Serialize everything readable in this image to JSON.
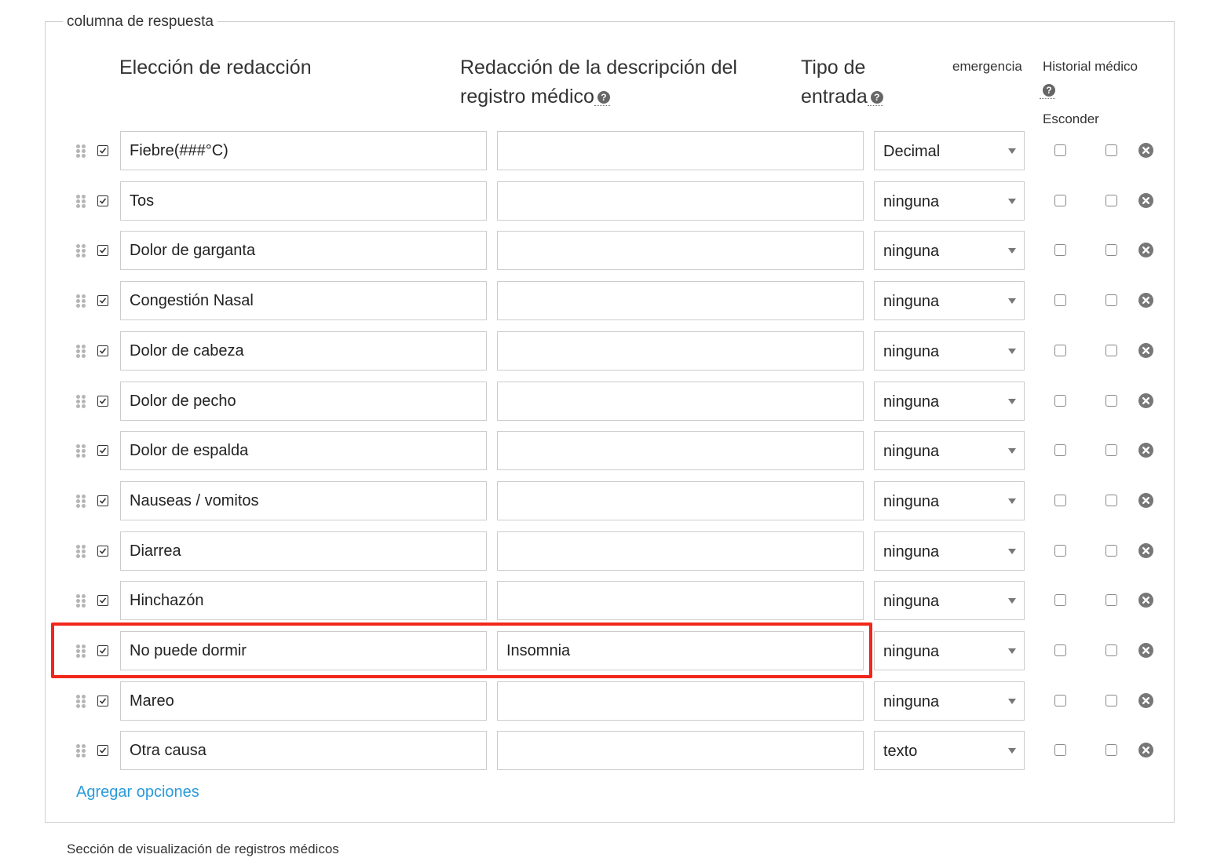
{
  "fieldset": {
    "legend": "columna de respuesta",
    "headers": {
      "choice": "Elección de redacción",
      "description": "Redacción de la descripción del registro médico",
      "input_type": "Tipo de entrada",
      "emergency": "emergencia",
      "medical_history": "Historial médico",
      "hide": "Esconder"
    },
    "rows": [
      {
        "choice": "Fiebre(###°C)",
        "description": "",
        "input_type": "Decimal"
      },
      {
        "choice": "Tos",
        "description": "",
        "input_type": "ninguna"
      },
      {
        "choice": "Dolor de garganta",
        "description": "",
        "input_type": "ninguna"
      },
      {
        "choice": "Congestión Nasal",
        "description": "",
        "input_type": "ninguna"
      },
      {
        "choice": "Dolor de cabeza",
        "description": "",
        "input_type": "ninguna"
      },
      {
        "choice": "Dolor de pecho",
        "description": "",
        "input_type": "ninguna"
      },
      {
        "choice": "Dolor de espalda",
        "description": "",
        "input_type": "ninguna"
      },
      {
        "choice": "Nauseas / vomitos",
        "description": "",
        "input_type": "ninguna"
      },
      {
        "choice": "Diarrea",
        "description": "",
        "input_type": "ninguna"
      },
      {
        "choice": "Hinchazón",
        "description": "",
        "input_type": "ninguna"
      },
      {
        "choice": "No puede dormir",
        "description": "Insomnia",
        "input_type": "ninguna"
      },
      {
        "choice": "Mareo",
        "description": "",
        "input_type": "ninguna"
      },
      {
        "choice": "Otra causa",
        "description": "",
        "input_type": "texto"
      }
    ],
    "add_options_label": "Agregar opciones"
  },
  "footer": {
    "text": "Sección de visualización de registros médicos"
  },
  "colors": {
    "highlight": "#f2261a",
    "link": "#2a9bd9"
  }
}
